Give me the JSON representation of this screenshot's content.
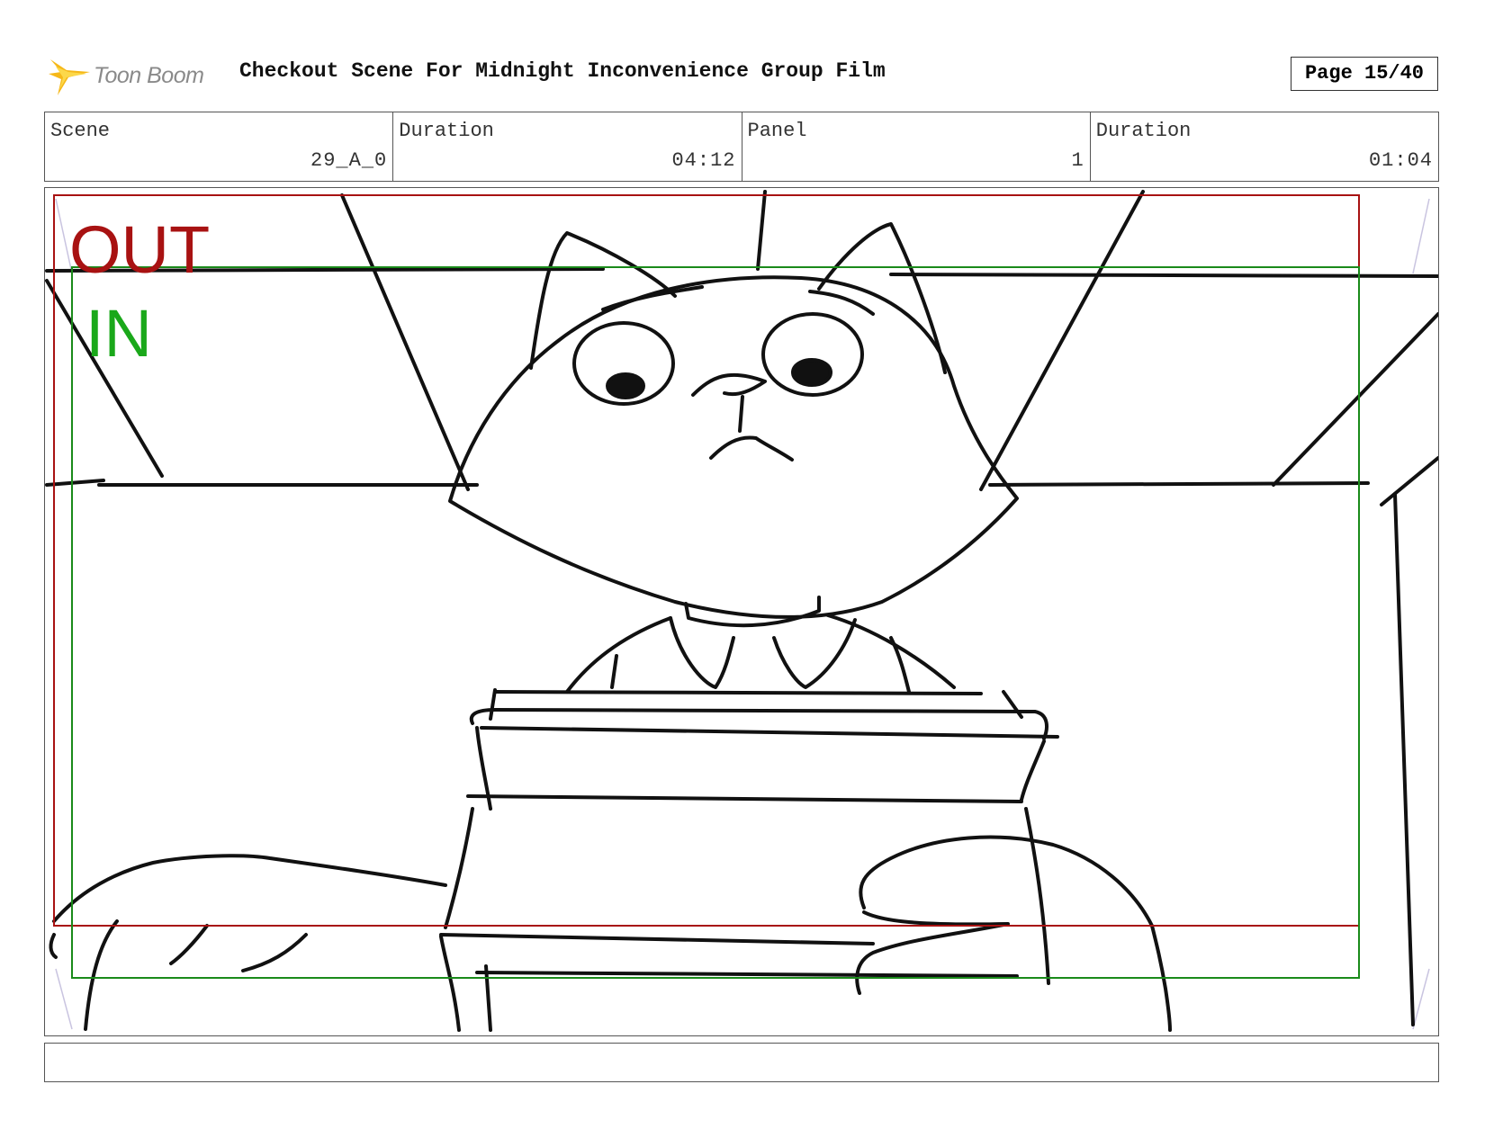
{
  "header": {
    "logo_text": "Toon Boom",
    "title": "Checkout Scene For Midnight Inconvenience Group Film",
    "page": "Page 15/40"
  },
  "info": [
    {
      "label": "Scene",
      "value": "29_A_0"
    },
    {
      "label": "Duration",
      "value": "04:12"
    },
    {
      "label": "Panel",
      "value": "1"
    },
    {
      "label": "Duration",
      "value": "01:04"
    }
  ],
  "panel": {
    "out_label": "OUT",
    "in_label": "IN",
    "colors": {
      "out_frame": "#a81212",
      "in_frame": "#1a8a1a",
      "sketch": "#111111"
    }
  },
  "caption": ""
}
